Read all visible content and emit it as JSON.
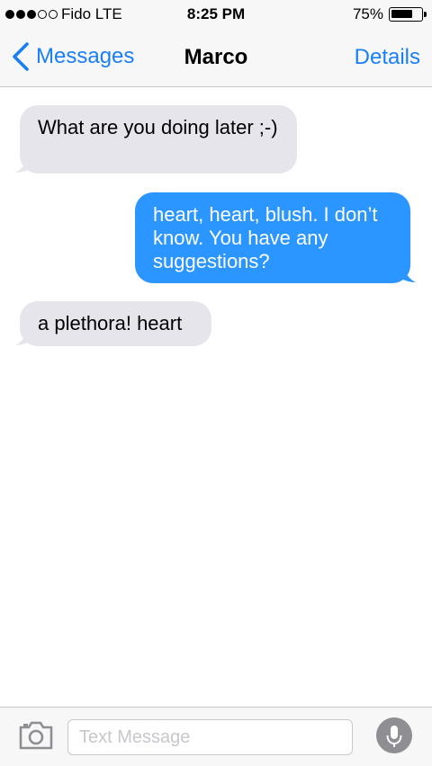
{
  "status_bar": {
    "carrier": "Fido  LTE",
    "time": "8:25 PM",
    "battery_percent": "75%",
    "battery_level": 0.75,
    "signal_bars_filled": 3,
    "signal_bars_total": 5
  },
  "nav": {
    "back_label": "Messages",
    "title": "Marco",
    "details_label": "Details"
  },
  "messages": [
    {
      "direction": "incoming",
      "text": "What are you doing later ;-)"
    },
    {
      "direction": "outgoing",
      "text": "heart, heart, blush. I don’t know. You have any suggestions?"
    },
    {
      "direction": "incoming",
      "text": "a plethora! heart"
    }
  ],
  "input": {
    "placeholder": "Text Message",
    "value": ""
  },
  "colors": {
    "accent": "#1a7ff5",
    "outgoing_bubble": "#2b96ff",
    "incoming_bubble": "#e6e5eb",
    "bar_background": "#f7f7f7",
    "icon_gray": "#8e8e93"
  },
  "icons": {
    "back": "chevron-left-icon",
    "camera": "camera-icon",
    "mic": "microphone-icon"
  }
}
